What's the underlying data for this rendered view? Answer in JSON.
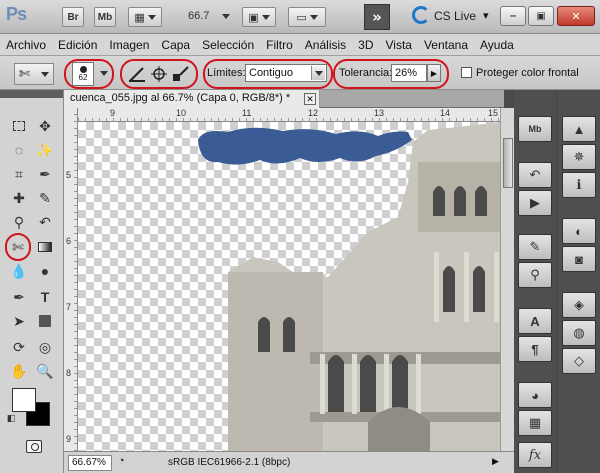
{
  "appbar": {
    "logo": "Ps",
    "bridge_label": "Br",
    "minibridge_label": "Mb",
    "zoom_level": "66.7",
    "cs_live_label": "CS Live",
    "cs_live_dropdown": "▾",
    "min_icon": "minimize-icon",
    "max_icon": "maximize-icon",
    "close_icon": "close-icon"
  },
  "menu": {
    "items": [
      "Archivo",
      "Edición",
      "Imagen",
      "Capa",
      "Selección",
      "Filtro",
      "Análisis",
      "3D",
      "Vista",
      "Ventana",
      "Ayuda"
    ]
  },
  "options": {
    "brush_size": "62",
    "limits_label": "Límites:",
    "limits_value": "Contiguo",
    "tolerance_label": "Tolerancia:",
    "tolerance_value": "26%",
    "protect_label": "Proteger color frontal",
    "protect_checked": false
  },
  "document": {
    "tab_title": "cuenca_055.jpg al 66.7% (Capa 0, RGB/8*) *",
    "ruler_h": [
      "9",
      "10",
      "11",
      "12",
      "13",
      "14",
      "15"
    ],
    "ruler_v": [
      "5",
      "6",
      "7",
      "8",
      "9"
    ],
    "zoom": "66.67%",
    "status": "sRGB IEC61966-2.1 (8bpc)"
  },
  "colors": {
    "highlight": "#d0141c",
    "sky": "#3b5b95",
    "stone": "#c9c6bd"
  }
}
